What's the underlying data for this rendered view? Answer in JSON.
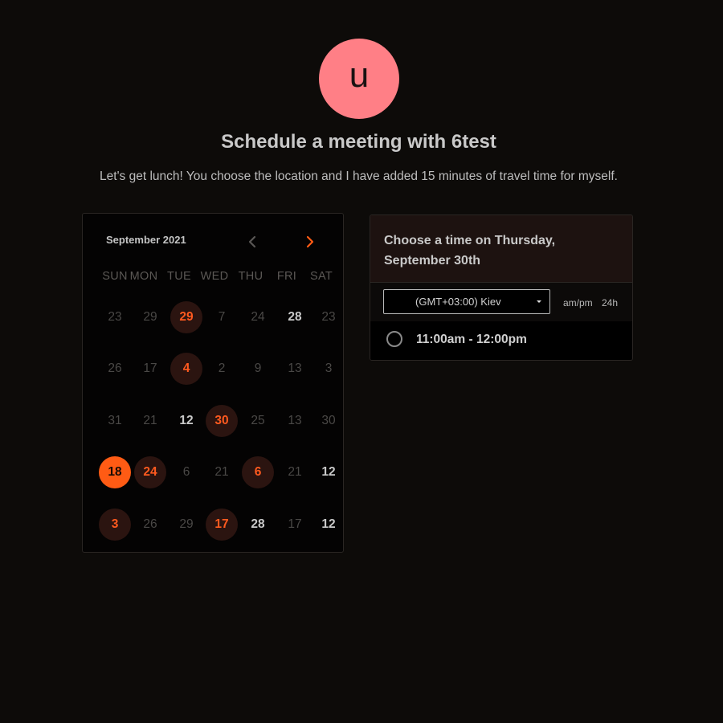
{
  "avatar": {
    "initial": "u",
    "color": "#ff7f86"
  },
  "header": {
    "title": "Schedule a meeting with 6test",
    "subtitle": "Let's get lunch! You choose the location and I have added 15 minutes of travel time for myself."
  },
  "calendar": {
    "month_label": "September 2021",
    "prev_icon": "chevron-left-icon",
    "next_icon": "chevron-right-icon",
    "weekdays": [
      "SUN",
      "MON",
      "TUE",
      "WED",
      "THU",
      "FRI",
      "SAT"
    ],
    "weeks": [
      [
        {
          "d": "23",
          "s": "muted"
        },
        {
          "d": "29",
          "s": "muted"
        },
        {
          "d": "29",
          "s": "avail"
        },
        {
          "d": "7",
          "s": "muted"
        },
        {
          "d": "24",
          "s": "muted"
        },
        {
          "d": "28",
          "s": "bold"
        },
        {
          "d": "23",
          "s": "muted"
        }
      ],
      [
        {
          "d": "26",
          "s": "muted"
        },
        {
          "d": "17",
          "s": "muted"
        },
        {
          "d": "4",
          "s": "avail"
        },
        {
          "d": "2",
          "s": "muted"
        },
        {
          "d": "9",
          "s": "muted"
        },
        {
          "d": "13",
          "s": "muted"
        },
        {
          "d": "3",
          "s": "muted"
        }
      ],
      [
        {
          "d": "31",
          "s": "muted"
        },
        {
          "d": "21",
          "s": "muted"
        },
        {
          "d": "12",
          "s": "bold"
        },
        {
          "d": "30",
          "s": "avail"
        },
        {
          "d": "25",
          "s": "muted"
        },
        {
          "d": "13",
          "s": "muted"
        },
        {
          "d": "30",
          "s": "muted"
        }
      ],
      [
        {
          "d": "18",
          "s": "selected"
        },
        {
          "d": "24",
          "s": "avail"
        },
        {
          "d": "6",
          "s": "muted"
        },
        {
          "d": "21",
          "s": "muted"
        },
        {
          "d": "6",
          "s": "avail"
        },
        {
          "d": "21",
          "s": "muted"
        },
        {
          "d": "12",
          "s": "bold"
        }
      ],
      [
        {
          "d": "3",
          "s": "avail"
        },
        {
          "d": "26",
          "s": "muted"
        },
        {
          "d": "29",
          "s": "muted"
        },
        {
          "d": "17",
          "s": "avail"
        },
        {
          "d": "28",
          "s": "bold"
        },
        {
          "d": "17",
          "s": "muted"
        },
        {
          "d": "12",
          "s": "bold"
        }
      ]
    ],
    "colors": {
      "accent": "#ff5b14",
      "available_bg": "#2b1410"
    }
  },
  "times": {
    "title": "Choose a time on Thursday, September 30th",
    "timezone": "(GMT+03:00) Kiev",
    "format_12h": "am/pm",
    "format_24h": "24h",
    "slots": [
      "11:00am - 12:00pm"
    ]
  }
}
